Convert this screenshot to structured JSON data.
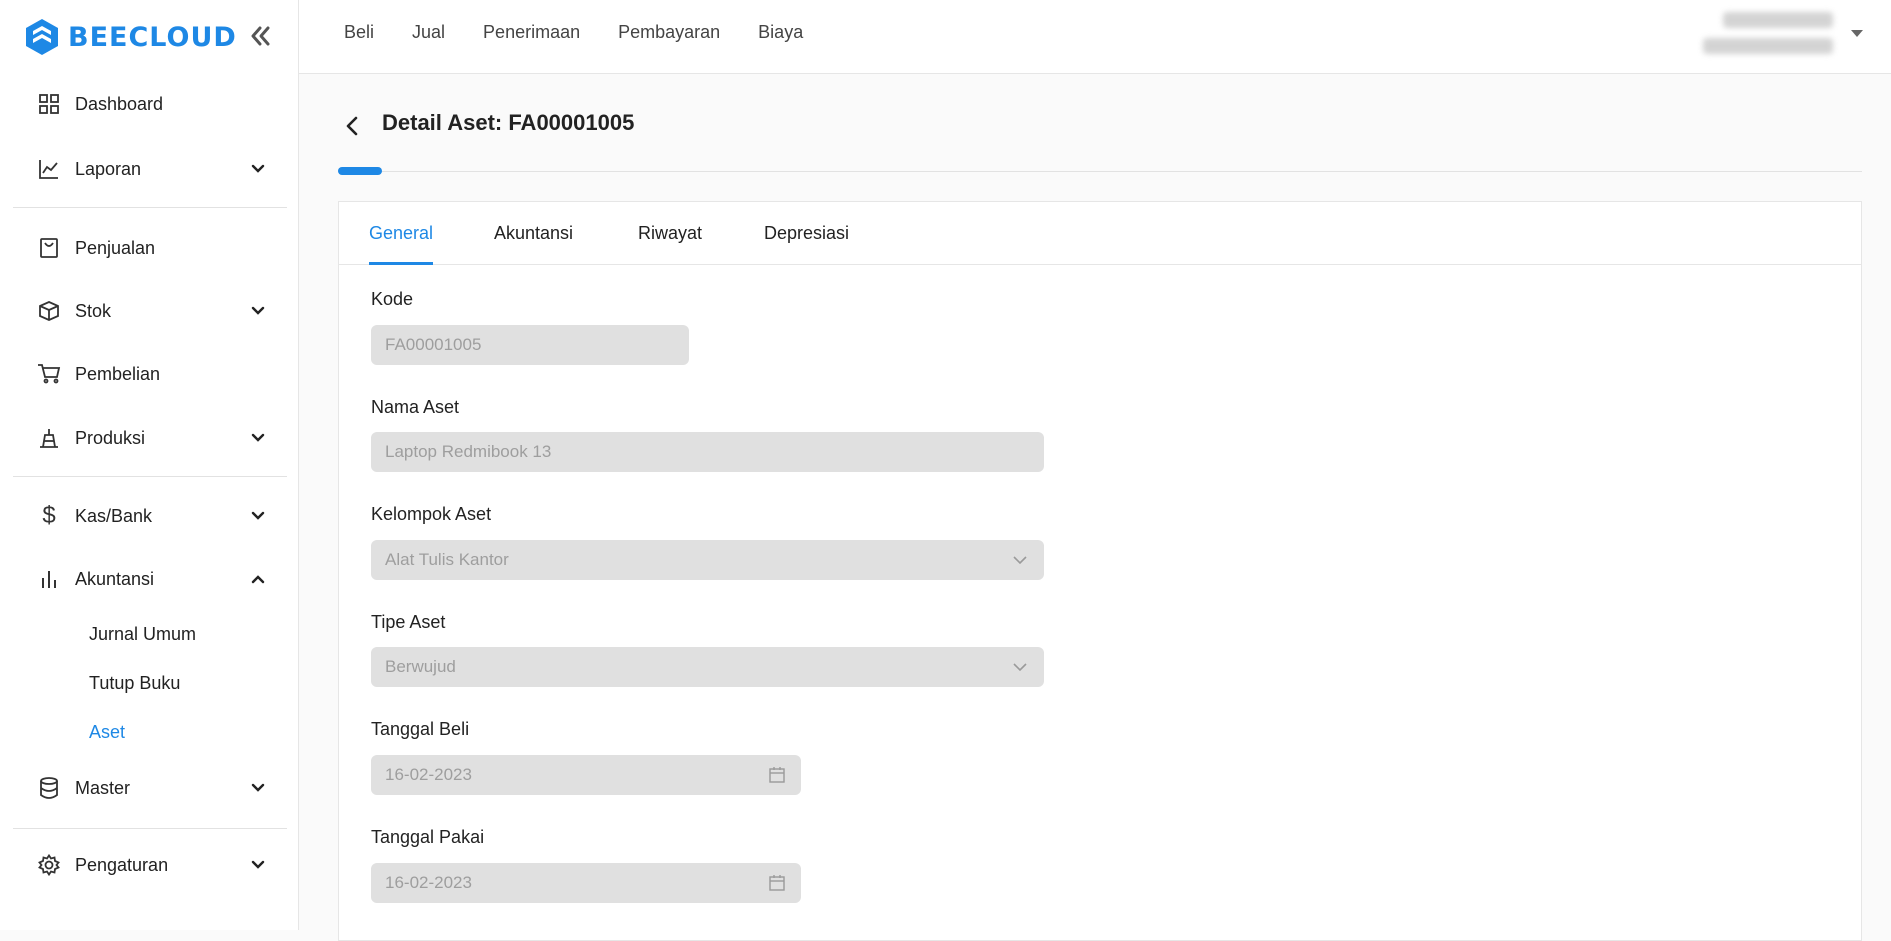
{
  "brand": {
    "name": "BEECLOUD",
    "color": "#1e88e5"
  },
  "sidebar": {
    "items": [
      {
        "label": "Dashboard",
        "icon": "grid-icon"
      },
      {
        "label": "Laporan",
        "icon": "chart-line-icon"
      },
      {
        "label": "Penjualan",
        "icon": "shopping-bag-icon"
      },
      {
        "label": "Stok",
        "icon": "box-icon"
      },
      {
        "label": "Pembelian",
        "icon": "cart-icon"
      },
      {
        "label": "Produksi",
        "icon": "factory-icon"
      },
      {
        "label": "Kas/Bank",
        "icon": "dollar-icon"
      },
      {
        "label": "Akuntansi",
        "icon": "bar-chart-icon"
      },
      {
        "label": "Master",
        "icon": "database-icon"
      },
      {
        "label": "Pengaturan",
        "icon": "gear-icon"
      }
    ],
    "akuntansi_sub": [
      "Jurnal Umum",
      "Tutup Buku",
      "Aset"
    ],
    "active_sub": "Aset"
  },
  "topnav": [
    "Beli",
    "Jual",
    "Penerimaan",
    "Pembayaran",
    "Biaya"
  ],
  "page": {
    "title": "Detail Aset: FA00001005",
    "progress_percent": 3
  },
  "tabs": [
    "General",
    "Akuntansi",
    "Riwayat",
    "Depresiasi"
  ],
  "active_tab": "General",
  "form": {
    "kode": {
      "label": "Kode",
      "value": "FA00001005"
    },
    "nama_aset": {
      "label": "Nama Aset",
      "value": "Laptop Redmibook 13"
    },
    "kelompok_aset": {
      "label": "Kelompok Aset",
      "value": "Alat Tulis Kantor"
    },
    "tipe_aset": {
      "label": "Tipe Aset",
      "value": "Berwujud"
    },
    "tanggal_beli": {
      "label": "Tanggal Beli",
      "value": "16-02-2023"
    },
    "tanggal_pakai": {
      "label": "Tanggal Pakai",
      "value": "16-02-2023"
    }
  }
}
